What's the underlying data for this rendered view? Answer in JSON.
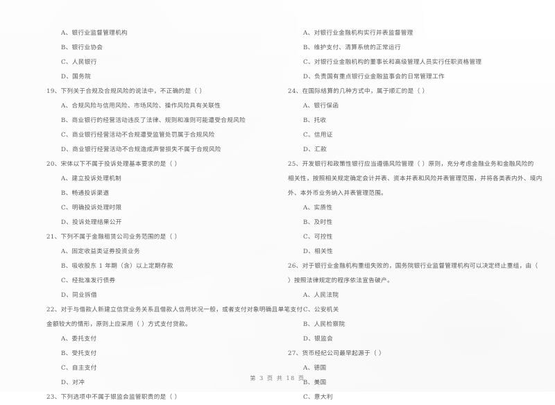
{
  "document": {
    "type": "exam-paper-scan",
    "language": "zh-CN",
    "footer": "第 3 页 共 18 页",
    "text_color": "#4a4a4a",
    "background_color": "#fefefe"
  },
  "left_column": {
    "blocks": [
      {
        "kind": "option",
        "text": "A、银行业监督管理机构"
      },
      {
        "kind": "option",
        "text": "B、银行业协会"
      },
      {
        "kind": "option",
        "text": "C、人民银行"
      },
      {
        "kind": "option",
        "text": "D、国务院"
      },
      {
        "kind": "question",
        "text": "19、下列关于合规及合规风险的说法中，不正确的是（      ）"
      },
      {
        "kind": "option",
        "text": "A、合规风险与信用风险、市场风险、操作风险具有关联性"
      },
      {
        "kind": "option",
        "text": "B、商业银行的经营活动违反了法律、规则和准则可能遭受合规风险"
      },
      {
        "kind": "option",
        "text": "C、商业银行经营活动不合规遭受监管处罚属于合规风险"
      },
      {
        "kind": "option",
        "text": "D、商业银行经营活动不合规造成声誉损失不属于合规风险"
      },
      {
        "kind": "question",
        "text": "20、宋体以下不属于投诉处理基本要求的是（      ）"
      },
      {
        "kind": "option",
        "text": "A、建立投诉处理机制"
      },
      {
        "kind": "option",
        "text": "B、畅通投诉渠道"
      },
      {
        "kind": "option",
        "text": "C、明确投诉处理时限"
      },
      {
        "kind": "option",
        "text": "D、投诉处理结果公开"
      },
      {
        "kind": "question",
        "text": "21、下列不属于金融租赁公司业务范围的是（      ）"
      },
      {
        "kind": "option",
        "text": "A、固定收益类证券投资业务"
      },
      {
        "kind": "option",
        "text": "B、吸收股东 1 年期（含）以上定期存款"
      },
      {
        "kind": "option",
        "text": "C、经批准发行债券"
      },
      {
        "kind": "option",
        "text": "D、同业拆借"
      },
      {
        "kind": "question",
        "text": "22、对于与借款人新建立信贷业务关系且借款人信用状况一般，或者支付对象明确且单笔支付"
      },
      {
        "kind": "continue",
        "text": "金额较大的情形，原则上应采用（      ）方式支付贷款。"
      },
      {
        "kind": "option",
        "text": "A、委托支付"
      },
      {
        "kind": "option",
        "text": "B、受托支付"
      },
      {
        "kind": "option",
        "text": "C、自主支付"
      },
      {
        "kind": "option",
        "text": "D、对冲"
      },
      {
        "kind": "question",
        "text": "23、下列选项中不属于银监会监管职责的是（      ）"
      }
    ]
  },
  "right_column": {
    "blocks": [
      {
        "kind": "option",
        "text": "A、对银行业金融机构实行并表监督管理"
      },
      {
        "kind": "option",
        "text": "B、维护支付、清算系统的正常运行"
      },
      {
        "kind": "option",
        "text": "C、对银行业金融机构的董事长和高级管理人员实行任职资格管理"
      },
      {
        "kind": "option",
        "text": "D、负责国有重点银行业金融监事会的日常管理工作"
      },
      {
        "kind": "question",
        "text": "24、在国际结算的几种方式中，属于顺汇的是（      ）"
      },
      {
        "kind": "option",
        "text": "A、银行保函"
      },
      {
        "kind": "option",
        "text": "B、托收"
      },
      {
        "kind": "option",
        "text": "C、信用证"
      },
      {
        "kind": "option",
        "text": "D、汇款"
      },
      {
        "kind": "question",
        "text": "25、开发银行和政策性银行应当遵循风险管理（      ）原则，充分考虑金融业务和金融风险的"
      },
      {
        "kind": "continue",
        "text": "相关性，按照相关规定确定会计并表、资本并表和风险并表管理范围，并将各类表内外、境内"
      },
      {
        "kind": "continue",
        "text": "外、本外币业务纳入并表管理范围。"
      },
      {
        "kind": "option",
        "text": "A、实质性"
      },
      {
        "kind": "option",
        "text": "B、及时性"
      },
      {
        "kind": "option",
        "text": "C、可控性"
      },
      {
        "kind": "option",
        "text": "D、相关性"
      },
      {
        "kind": "question",
        "text": "26、对于银行业金融机构重组失败的，国务院银行业监督管理机构可以决定终止重组，由（"
      },
      {
        "kind": "continue",
        "text": "）按照法律规定的程序依法宣告破产。"
      },
      {
        "kind": "option",
        "text": "A、人民法院"
      },
      {
        "kind": "option",
        "text": "C、公安机关"
      },
      {
        "kind": "option",
        "text": "B、人民检察院"
      },
      {
        "kind": "option",
        "text": "D、银监会"
      },
      {
        "kind": "question",
        "text": "27、货币经纪公司最早起源于（      ）"
      },
      {
        "kind": "option",
        "text": "A、德国"
      },
      {
        "kind": "option",
        "text": "B、美国"
      },
      {
        "kind": "option",
        "text": "C、意大利"
      }
    ]
  }
}
